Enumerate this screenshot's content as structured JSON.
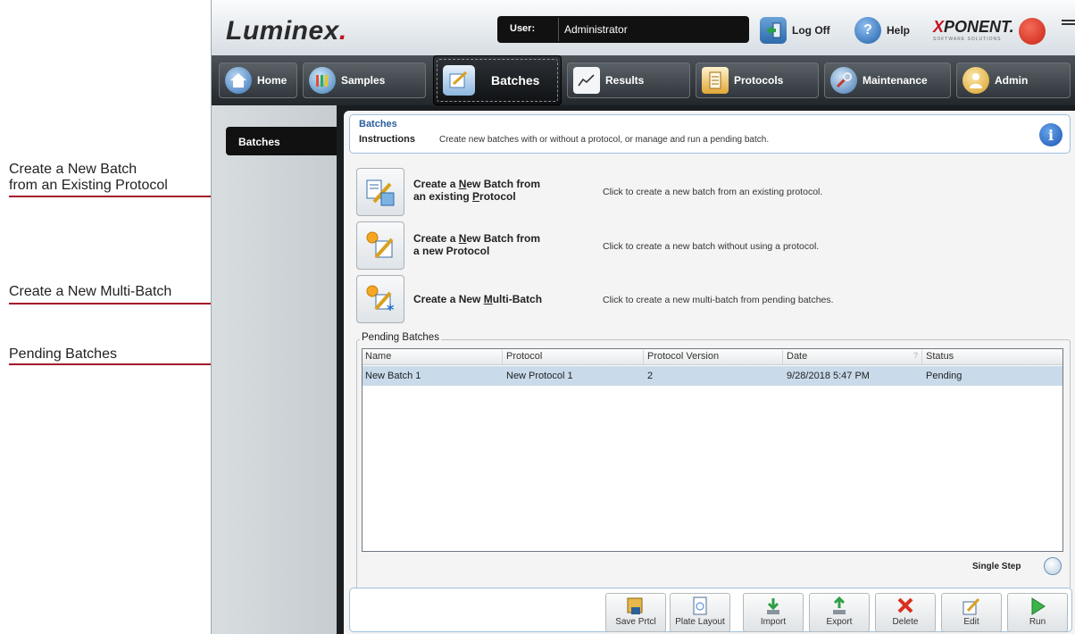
{
  "annotations": {
    "new_batch_existing_line1": "Create a New Batch",
    "new_batch_existing_line2": "from an Existing Protocol",
    "multi_batch": "Create a New Multi-Batch",
    "pending": "Pending Batches"
  },
  "header": {
    "logo_text": "Luminex",
    "logo_dot": ".",
    "user_label": "User:",
    "user_value": "Administrator",
    "logoff_label": "Log Off",
    "help_label": "Help",
    "help_icon_glyph": "?",
    "brand_x": "X",
    "brand_rest": "PONENT.",
    "brand_sub": "SOFTWARE SOLUTIONS"
  },
  "nav": {
    "home": "Home",
    "samples": "Samples",
    "batches": "Batches",
    "results": "Results",
    "protocols": "Protocols",
    "maintenance": "Maintenance",
    "admin": "Admin"
  },
  "sidebar": {
    "batches": "Batches"
  },
  "instructions": {
    "title": "Batches",
    "label": "Instructions",
    "text": "Create new batches with or without a protocol, or manage and run a pending batch.",
    "info_glyph": "i"
  },
  "actions": {
    "existing": {
      "line1_pre": "Create a ",
      "line1_u": "N",
      "line1_post": "ew Batch from",
      "line2_pre": "an existing ",
      "line2_u": "P",
      "line2_post": "rotocol",
      "desc": "Click to create a new batch from an existing protocol."
    },
    "new_protocol": {
      "line1_pre": "Create a ",
      "line1_u": "N",
      "line1_post": "ew Batch from",
      "line2": "a new Protocol",
      "desc": "Click to create a new batch without using a protocol."
    },
    "multi": {
      "pre": "Create a New ",
      "u": "M",
      "post": "ulti-Batch",
      "desc": "Click to create a new multi-batch from pending batches."
    }
  },
  "pending": {
    "label": "Pending Batches",
    "columns": [
      "Name",
      "Protocol",
      "Protocol Version",
      "Date",
      "Status"
    ],
    "sort_glyph": "?",
    "rows": [
      [
        "New Batch 1",
        "New Protocol 1",
        "2",
        "9/28/2018 5:47 PM",
        "Pending"
      ]
    ]
  },
  "single_step": "Single Step",
  "toolbar": {
    "save_protocol": "Save Prtcl",
    "plate_layout": "Plate Layout",
    "import": "Import",
    "export": "Export",
    "delete": "Delete",
    "edit": "Edit",
    "run": "Run"
  },
  "colors": {
    "annotation_arrow": "#a3162b",
    "accent_blue": "#2a5e9c",
    "selected_row": "#c9daea"
  }
}
